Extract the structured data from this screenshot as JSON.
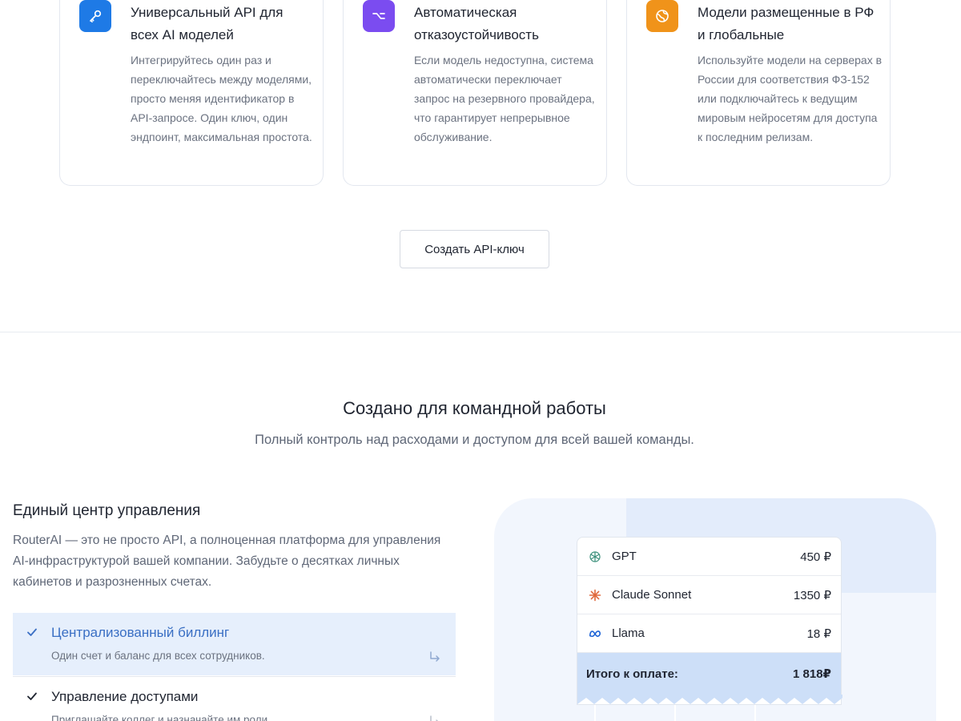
{
  "features": [
    {
      "icon": "key-icon",
      "icon_color": "#1e7ae6",
      "title": "Универсальный API для всех AI моделей",
      "text": "Интегрируйтесь один раз и переключайтесь между моделями, просто меняя идентификатор в API-запросе. Один ключ, один эндпоинт, максимальная простота."
    },
    {
      "icon": "option-switch-icon",
      "icon_color": "#7b4cf0",
      "title": "Автоматическая отказоустойчивость",
      "text": "Если модель недоступна, система автоматически переключает запрос на резервного провайдера, что гарантирует непрерывное обслуживание."
    },
    {
      "icon": "globe-icon",
      "icon_color": "#f0931a",
      "title": "Модели размещенные в РФ и глобальные",
      "text": "Используйте модели на серверах в России для соответствия ФЗ-152 или подключайтесь к ведущим мировым нейросетям для доступа к последним релизам."
    }
  ],
  "cta": {
    "label": "Создать API-ключ"
  },
  "team": {
    "title": "Создано для командной работы",
    "subtitle": "Полный контроль над расходами и доступом для всей вашей команды.",
    "left_title": "Единый центр управления",
    "left_text": "RouterAI — это не просто API, а полноценная платформа для управления AI-инфраструктурой вашей компании. Забудьте о десятках личных кабинетов и разрозненных счетах.",
    "items": [
      {
        "name": "Централизованный биллинг",
        "desc": "Один счет и баланс для всех сотрудников.",
        "active": true
      },
      {
        "name": "Управление доступами",
        "desc": "Приглашайте коллег и назначайте им роли",
        "active": false
      }
    ]
  },
  "receipt": {
    "rows": [
      {
        "icon": "openai-icon",
        "name": "GPT",
        "price": "450 ₽"
      },
      {
        "icon": "anthropic-icon",
        "name": "Claude Sonnet",
        "price": "1350 ₽"
      },
      {
        "icon": "meta-icon",
        "name": "Llama",
        "price": "18 ₽"
      }
    ],
    "total_label": "Итого к оплате:",
    "total_value": "1 818₽"
  },
  "colors": {
    "accent": "#3a6fc4",
    "active_bg": "#e6effc",
    "total_bg": "#cddff8"
  }
}
